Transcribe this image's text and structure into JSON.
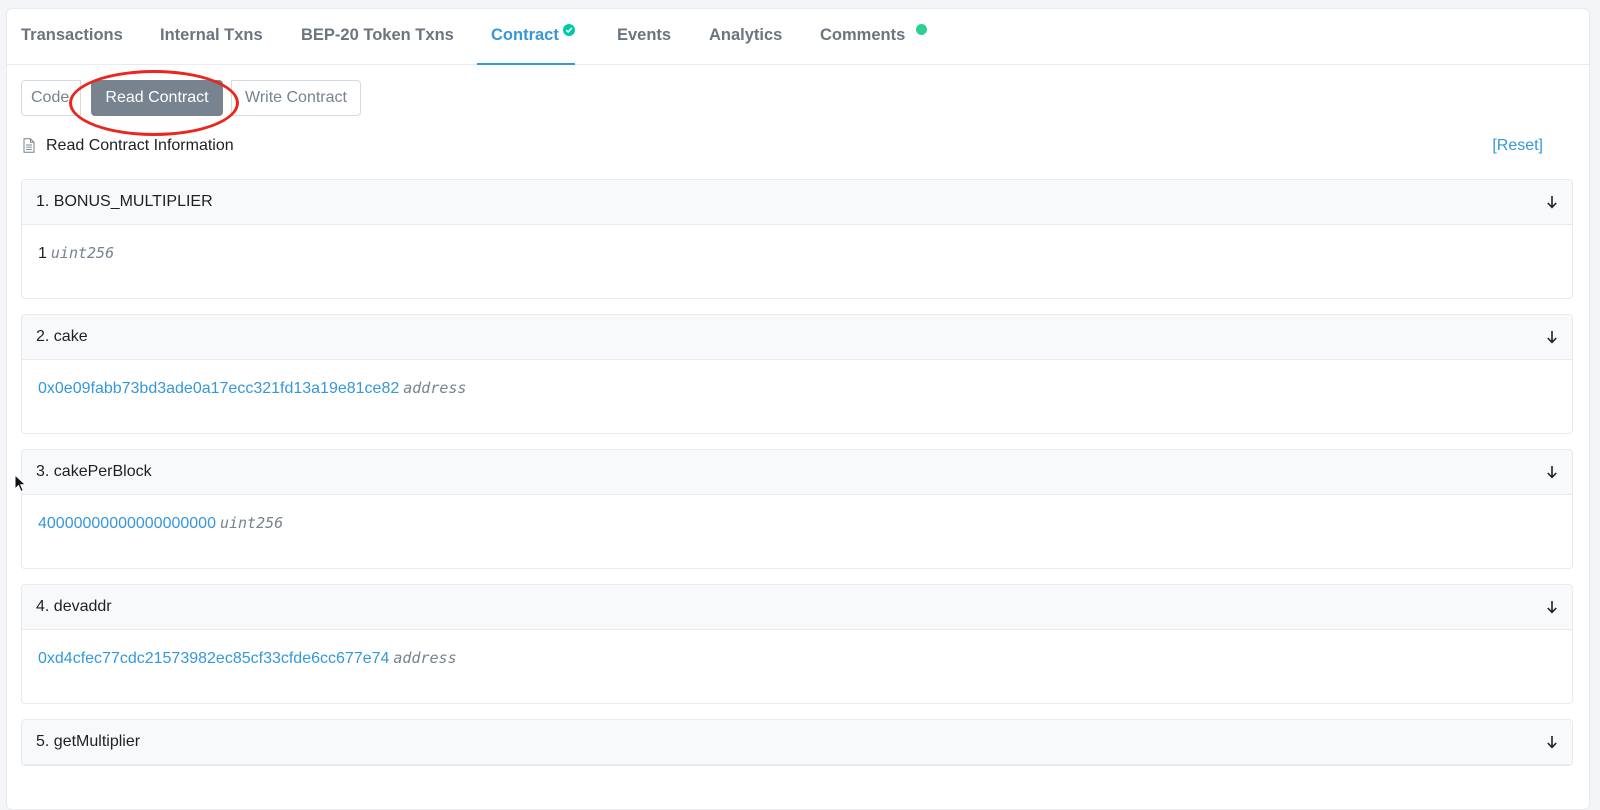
{
  "tabs": [
    {
      "label": "Transactions"
    },
    {
      "label": "Internal Txns"
    },
    {
      "label": "BEP-20 Token Txns"
    },
    {
      "label": "Contract",
      "active": true
    },
    {
      "label": "Events"
    },
    {
      "label": "Analytics"
    },
    {
      "label": "Comments"
    }
  ],
  "subnav": {
    "code": "Code",
    "read": "Read Contract",
    "write": "Write Contract"
  },
  "info": {
    "label": "Read Contract Information",
    "reset": "[Reset]"
  },
  "functions": [
    {
      "title": "1. BONUS_MULTIPLIER",
      "value": "1",
      "type": "uint256",
      "is_link": false
    },
    {
      "title": "2. cake",
      "value": "0x0e09fabb73bd3ade0a17ecc321fd13a19e81ce82",
      "type": "address",
      "is_link": true
    },
    {
      "title": "3. cakePerBlock",
      "value": "40000000000000000000",
      "type": "uint256",
      "is_link": true
    },
    {
      "title": "4. devaddr",
      "value": "0xd4cfec77cdc21573982ec85cf33cfde6cc677e74",
      "type": "address",
      "is_link": true
    },
    {
      "title": "5. getMultiplier",
      "value": "",
      "type": "",
      "is_link": false
    }
  ],
  "colors": {
    "accent": "#3498db",
    "verified": "#00c9a7",
    "highlight_ring": "#e8271f",
    "active_button": "#77838f"
  },
  "icons": {
    "verified": "check-circle-icon",
    "new_comment": "dot-icon",
    "info": "document-icon",
    "expand": "arrow-down-icon",
    "pointer": "mouse-cursor-icon"
  }
}
